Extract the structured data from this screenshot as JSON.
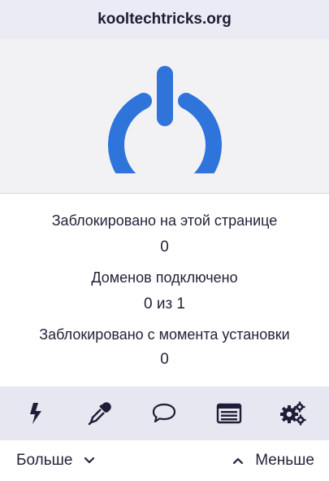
{
  "header": {
    "site": "kooltechtricks.org"
  },
  "power": {
    "icon": "power-icon",
    "color": "#2f74db",
    "state": "on"
  },
  "stats": [
    {
      "label": "Заблокировано на этой странице",
      "value": "0"
    },
    {
      "label": "Доменов подключено",
      "value": "0 из 1"
    },
    {
      "label": "Заблокировано с момента установки",
      "value": "0"
    }
  ],
  "toolbar": {
    "items": [
      {
        "icon": "lightning-icon"
      },
      {
        "icon": "eyedropper-icon"
      },
      {
        "icon": "speech-bubble-icon"
      },
      {
        "icon": "logger-list-icon"
      },
      {
        "icon": "gears-icon"
      }
    ]
  },
  "footer": {
    "more_label": "Больше",
    "less_label": "Меньше"
  }
}
